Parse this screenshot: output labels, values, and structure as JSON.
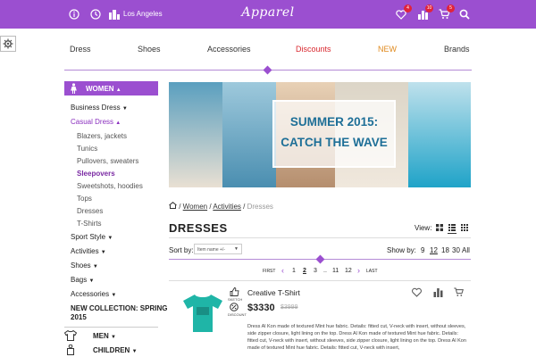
{
  "header": {
    "brand": "Apparel",
    "location": "Los Angeles",
    "wishlist_count": "4",
    "compare_count": "10",
    "cart_count": "5",
    "bg_color": "#9b4fd0"
  },
  "nav": {
    "items": [
      {
        "label": "Dress",
        "color": "#333333"
      },
      {
        "label": "Shoes",
        "color": "#333333"
      },
      {
        "label": "Accessories",
        "color": "#333333"
      },
      {
        "label": "Discounts",
        "color": "#d9282f"
      },
      {
        "label": "NEW",
        "color": "#e08a1e"
      },
      {
        "label": "Brands",
        "color": "#333333"
      }
    ]
  },
  "sidebar": {
    "header": "WOMEN",
    "items": [
      {
        "label": "Business Dress",
        "type": "parent",
        "caret": true
      },
      {
        "label": "Casual Dress",
        "type": "parent-active",
        "caret": true
      },
      {
        "label": "Blazers, jackets",
        "type": "sub"
      },
      {
        "label": "Tunics",
        "type": "sub"
      },
      {
        "label": "Pullovers, sweaters",
        "type": "sub"
      },
      {
        "label": "Sleepovers",
        "type": "sub-active"
      },
      {
        "label": "Sweetshots, hoodies",
        "type": "sub"
      },
      {
        "label": "Tops",
        "type": "sub"
      },
      {
        "label": "Dresses",
        "type": "sub"
      },
      {
        "label": "T-Shirts",
        "type": "sub"
      },
      {
        "label": "Sport Style",
        "type": "parent",
        "caret": true
      },
      {
        "label": "Activities",
        "type": "parent",
        "caret": true
      },
      {
        "label": "Shoes",
        "type": "parent",
        "caret": true
      },
      {
        "label": "Bags",
        "type": "parent",
        "caret": true
      },
      {
        "label": "Accessories",
        "type": "parent",
        "caret": true
      }
    ],
    "new_collection_line1": "NEW COLLECTION: SPRING",
    "new_collection_line2": "2015",
    "men": "MEN",
    "children": "CHILDREN"
  },
  "banner": {
    "line1": "SUMMER 2015:",
    "line2": "CATCH THE WAVE"
  },
  "breadcrumb": {
    "women": "Women",
    "activities": "Activities",
    "current": "Dresses"
  },
  "listing": {
    "title": "DRESSES",
    "view_label": "View:",
    "sort_label": "Sort by:",
    "sort_value": "Item name +/-",
    "show_label": "Show by:",
    "show_options": [
      "9",
      "12",
      "18",
      "30",
      "All"
    ],
    "show_selected": "12"
  },
  "pager": {
    "first": "FIRST",
    "last": "LAST",
    "pages": [
      "1",
      "2",
      "3",
      "..",
      "11",
      "12"
    ],
    "current": "2"
  },
  "product": {
    "name": "Creative T-Shirt",
    "price": "$3330",
    "old_price": "$3999",
    "sketch_label": "SKETCH",
    "discount_label": "DISCOUNT",
    "description": "Dress Al Kon made of textured Mint hue fabric. Details: fitted cut, V-neck with insert, without sleeves, side zipper closure, light lining on the top. Dress Al Kon made of textured Mint hue fabric. Details: fitted cut, V-neck with insert, without sleeves, side zipper closure, light lining on the top. Dress Al Kon made of textured Mint hue fabric. Details: fitted cut, V-neck with insert,",
    "shirt_color": "#1fb5a7"
  }
}
